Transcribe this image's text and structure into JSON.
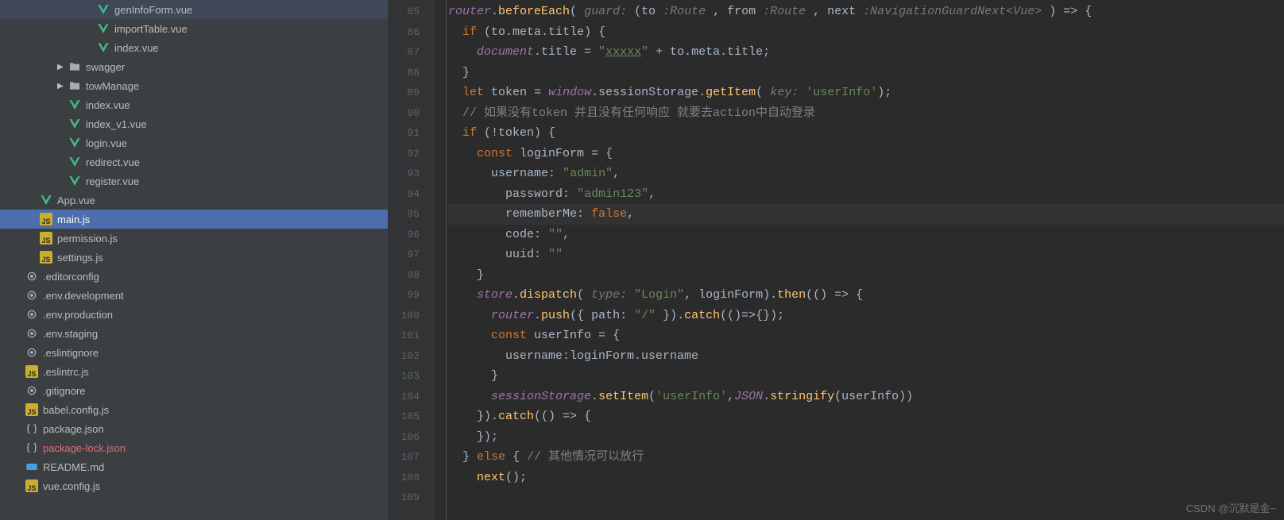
{
  "sidebar": {
    "items": [
      {
        "label": "genInfoForm.vue",
        "icon": "vue",
        "indent": 5
      },
      {
        "label": "importTable.vue",
        "icon": "vue",
        "indent": 5
      },
      {
        "label": "index.vue",
        "icon": "vue",
        "indent": 5
      },
      {
        "label": "swagger",
        "icon": "folder",
        "indent": 3,
        "chevron": "▶"
      },
      {
        "label": "towManage",
        "icon": "folder",
        "indent": 3,
        "chevron": "▶"
      },
      {
        "label": "index.vue",
        "icon": "vue",
        "indent": 3
      },
      {
        "label": "index_v1.vue",
        "icon": "vue",
        "indent": 3
      },
      {
        "label": "login.vue",
        "icon": "vue",
        "indent": 3
      },
      {
        "label": "redirect.vue",
        "icon": "vue",
        "indent": 3
      },
      {
        "label": "register.vue",
        "icon": "vue",
        "indent": 3
      },
      {
        "label": "App.vue",
        "icon": "vue",
        "indent": 1
      },
      {
        "label": "main.js",
        "icon": "js",
        "indent": 1,
        "selected": true
      },
      {
        "label": "permission.js",
        "icon": "js",
        "indent": 1
      },
      {
        "label": "settings.js",
        "icon": "js",
        "indent": 1
      },
      {
        "label": ".editorconfig",
        "icon": "config",
        "indent": 0
      },
      {
        "label": ".env.development",
        "icon": "config",
        "indent": 0
      },
      {
        "label": ".env.production",
        "icon": "config",
        "indent": 0
      },
      {
        "label": ".env.staging",
        "icon": "config",
        "indent": 0
      },
      {
        "label": ".eslintignore",
        "icon": "config",
        "indent": 0
      },
      {
        "label": ".eslintrc.js",
        "icon": "js",
        "indent": 0
      },
      {
        "label": ".gitignore",
        "icon": "config",
        "indent": 0
      },
      {
        "label": "babel.config.js",
        "icon": "js",
        "indent": 0
      },
      {
        "label": "package.json",
        "icon": "json",
        "indent": 0
      },
      {
        "label": "package-lock.json",
        "icon": "json",
        "indent": 0,
        "ignored": true
      },
      {
        "label": "README.md",
        "icon": "md",
        "indent": 0
      },
      {
        "label": "vue.config.js",
        "icon": "js",
        "indent": 0
      }
    ]
  },
  "gutter": {
    "start": 85,
    "end": 109
  },
  "code": {
    "lines": [
      {
        "n": 85,
        "html": "<span class='obj'>router</span><span class='punc'>.</span><span class='fn'>beforeEach</span><span class='punc'>( </span><span class='hint'>guard: </span><span class='punc'>(to </span><span class='hint'>:Route</span><span class='punc'> , from </span><span class='hint'>:Route</span><span class='punc'> , next </span><span class='hint'>:NavigationGuardNext&lt;Vue&gt;</span><span class='punc'> ) =&gt; {</span>"
      },
      {
        "n": 86,
        "html": "  <span class='kw'>if</span> <span class='punc'>(to.meta.title) {</span>"
      },
      {
        "n": 87,
        "html": "    <span class='obj'>document</span><span class='punc'>.title = </span><span class='str'>\"<span class='underline'>xxxxx</span>\"</span><span class='punc'> + to.meta.title;</span>"
      },
      {
        "n": 88,
        "html": "  <span class='punc'>}</span>"
      },
      {
        "n": 89,
        "html": "  <span class='kw'>let</span> <span class='ident'>token</span> <span class='punc'>=</span> <span class='obj'>window</span><span class='punc'>.sessionStorage.</span><span class='fn'>getItem</span><span class='punc'>( </span><span class='hint'>key: </span><span class='str'>'userInfo'</span><span class='punc'>);</span>"
      },
      {
        "n": 90,
        "html": "  <span class='cmt'>// 如果没有token 并且没有任何响应 就要去action中自动登录</span>"
      },
      {
        "n": 91,
        "html": "  <span class='kw'>if</span> <span class='punc'>(!token) {</span>"
      },
      {
        "n": 92,
        "html": "    <span class='kw'>const</span> <span class='ident'>loginForm</span> <span class='punc'>= {</span>"
      },
      {
        "n": 93,
        "html": "      <span class='ident'>username</span><span class='punc'>:</span> <span class='str'>\"admin\"</span><span class='punc'>,</span>"
      },
      {
        "n": 94,
        "html": "        <span class='ident'>password</span><span class='punc'>:</span> <span class='str'>\"admin123\"</span><span class='punc'>,</span>"
      },
      {
        "n": 95,
        "cursor": true,
        "html": "        <span class='ident'>rememberMe</span><span class='punc'>:</span> <span class='kw'>false</span><span class='punc'>,</span>"
      },
      {
        "n": 96,
        "html": "        <span class='ident'>code</span><span class='punc'>:</span> <span class='str'>\"\"</span><span class='punc'>,</span>"
      },
      {
        "n": 97,
        "html": "        <span class='ident'>uuid</span><span class='punc'>:</span> <span class='str'>\"\"</span>"
      },
      {
        "n": 98,
        "html": "    <span class='punc'>}</span>"
      },
      {
        "n": 99,
        "html": "    <span class='obj'>store</span><span class='punc'>.</span><span class='fn'>dispatch</span><span class='punc'>( </span><span class='hint'>type: </span><span class='str'>\"Login\"</span><span class='punc'>, loginForm).</span><span class='fn'>then</span><span class='punc'>(() =&gt; {</span>"
      },
      {
        "n": 100,
        "html": "      <span class='obj'>router</span><span class='punc'>.</span><span class='fn'>push</span><span class='punc'>({ </span><span class='ident'>path</span><span class='punc'>:</span> <span class='str'>\"/\"</span><span class='punc'> }).</span><span class='fn'>catch</span><span class='punc'>(()=&gt;{});</span>"
      },
      {
        "n": 101,
        "html": "      <span class='kw'>const</span> <span class='ident'>userInfo</span> <span class='punc'>= {</span>"
      },
      {
        "n": 102,
        "html": "        <span class='ident'>username</span><span class='punc'>:loginForm.username</span>"
      },
      {
        "n": 103,
        "html": "      <span class='punc'>}</span>"
      },
      {
        "n": 104,
        "html": "      <span class='obj'>sessionStorage</span><span class='punc'>.</span><span class='fn'>setItem</span><span class='punc'>(</span><span class='str'>'userInfo'</span><span class='punc'>,</span><span class='obj'>JSON</span><span class='punc'>.</span><span class='fn'>stringify</span><span class='punc'>(userInfo))</span>"
      },
      {
        "n": 105,
        "html": "    <span class='punc'>}).</span><span class='fn'>catch</span><span class='punc'>(() =&gt; {</span>"
      },
      {
        "n": 106,
        "html": "    <span class='punc'>});</span>"
      },
      {
        "n": 107,
        "html": "  <span class='punc'>}</span> <span class='kw'>else</span> <span class='punc'>{</span> <span class='cmt'>// 其他情况可以放行</span>"
      },
      {
        "n": 108,
        "html": "    <span class='fn'>next</span><span class='punc'>();</span>"
      },
      {
        "n": 109,
        "html": ""
      }
    ]
  },
  "watermark": "CSDN @沉默是金~"
}
